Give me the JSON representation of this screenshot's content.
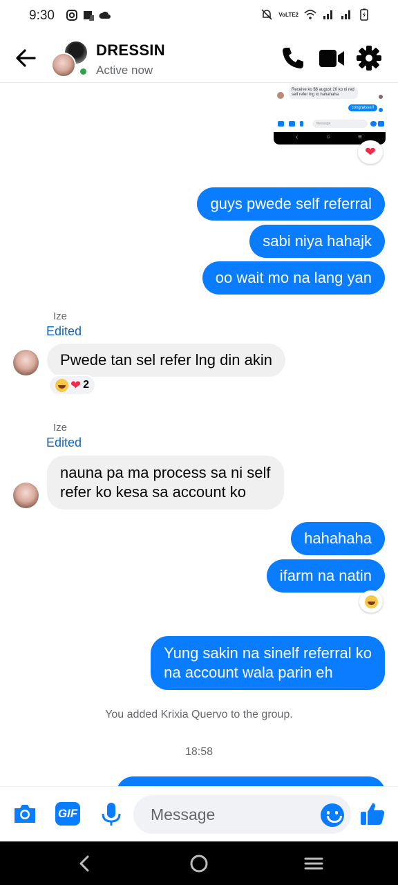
{
  "status_bar": {
    "time": "9:30",
    "network_label": "VoLTE2"
  },
  "header": {
    "title": "DRESSIN",
    "status": "Active now"
  },
  "shared_screenshot": {
    "incoming_text": "Receive ko $6 august 20 ko ni red self refer lng to hahahaha",
    "outgoing_text": "congratsss!!",
    "input_placeholder": "Message",
    "reaction": "❤"
  },
  "messages": [
    {
      "direction": "out",
      "text": "guys pwede self referral"
    },
    {
      "direction": "out",
      "text": "sabi niya hahajk"
    },
    {
      "direction": "out",
      "text": "oo wait mo na lang yan"
    },
    {
      "direction": "in",
      "sender": "Ize",
      "edited_label": "Edited",
      "text": "Pwede tan sel refer lng din akin",
      "reactions": {
        "count": "2"
      }
    },
    {
      "direction": "in",
      "sender": "Ize",
      "edited_label": "Edited",
      "lines": [
        "nauna pa ma process sa ni self",
        "refer ko kesa sa account ko"
      ]
    },
    {
      "direction": "out",
      "text": "hahahaha"
    },
    {
      "direction": "out",
      "text": "ifarm na natin"
    },
    {
      "direction": "out",
      "lines": [
        "Yung sakin na sinelf referral ko",
        "na account wala parin eh"
      ]
    }
  ],
  "system_note": "You added Krixia Quervo to the group.",
  "timestamp": "18:58",
  "composer": {
    "gif_label": "GIF",
    "placeholder": "Message"
  },
  "colors": {
    "accent": "#0a7cff",
    "incoming_bubble": "#f0f0f0",
    "online": "#31a24c",
    "heart": "#f02849"
  }
}
